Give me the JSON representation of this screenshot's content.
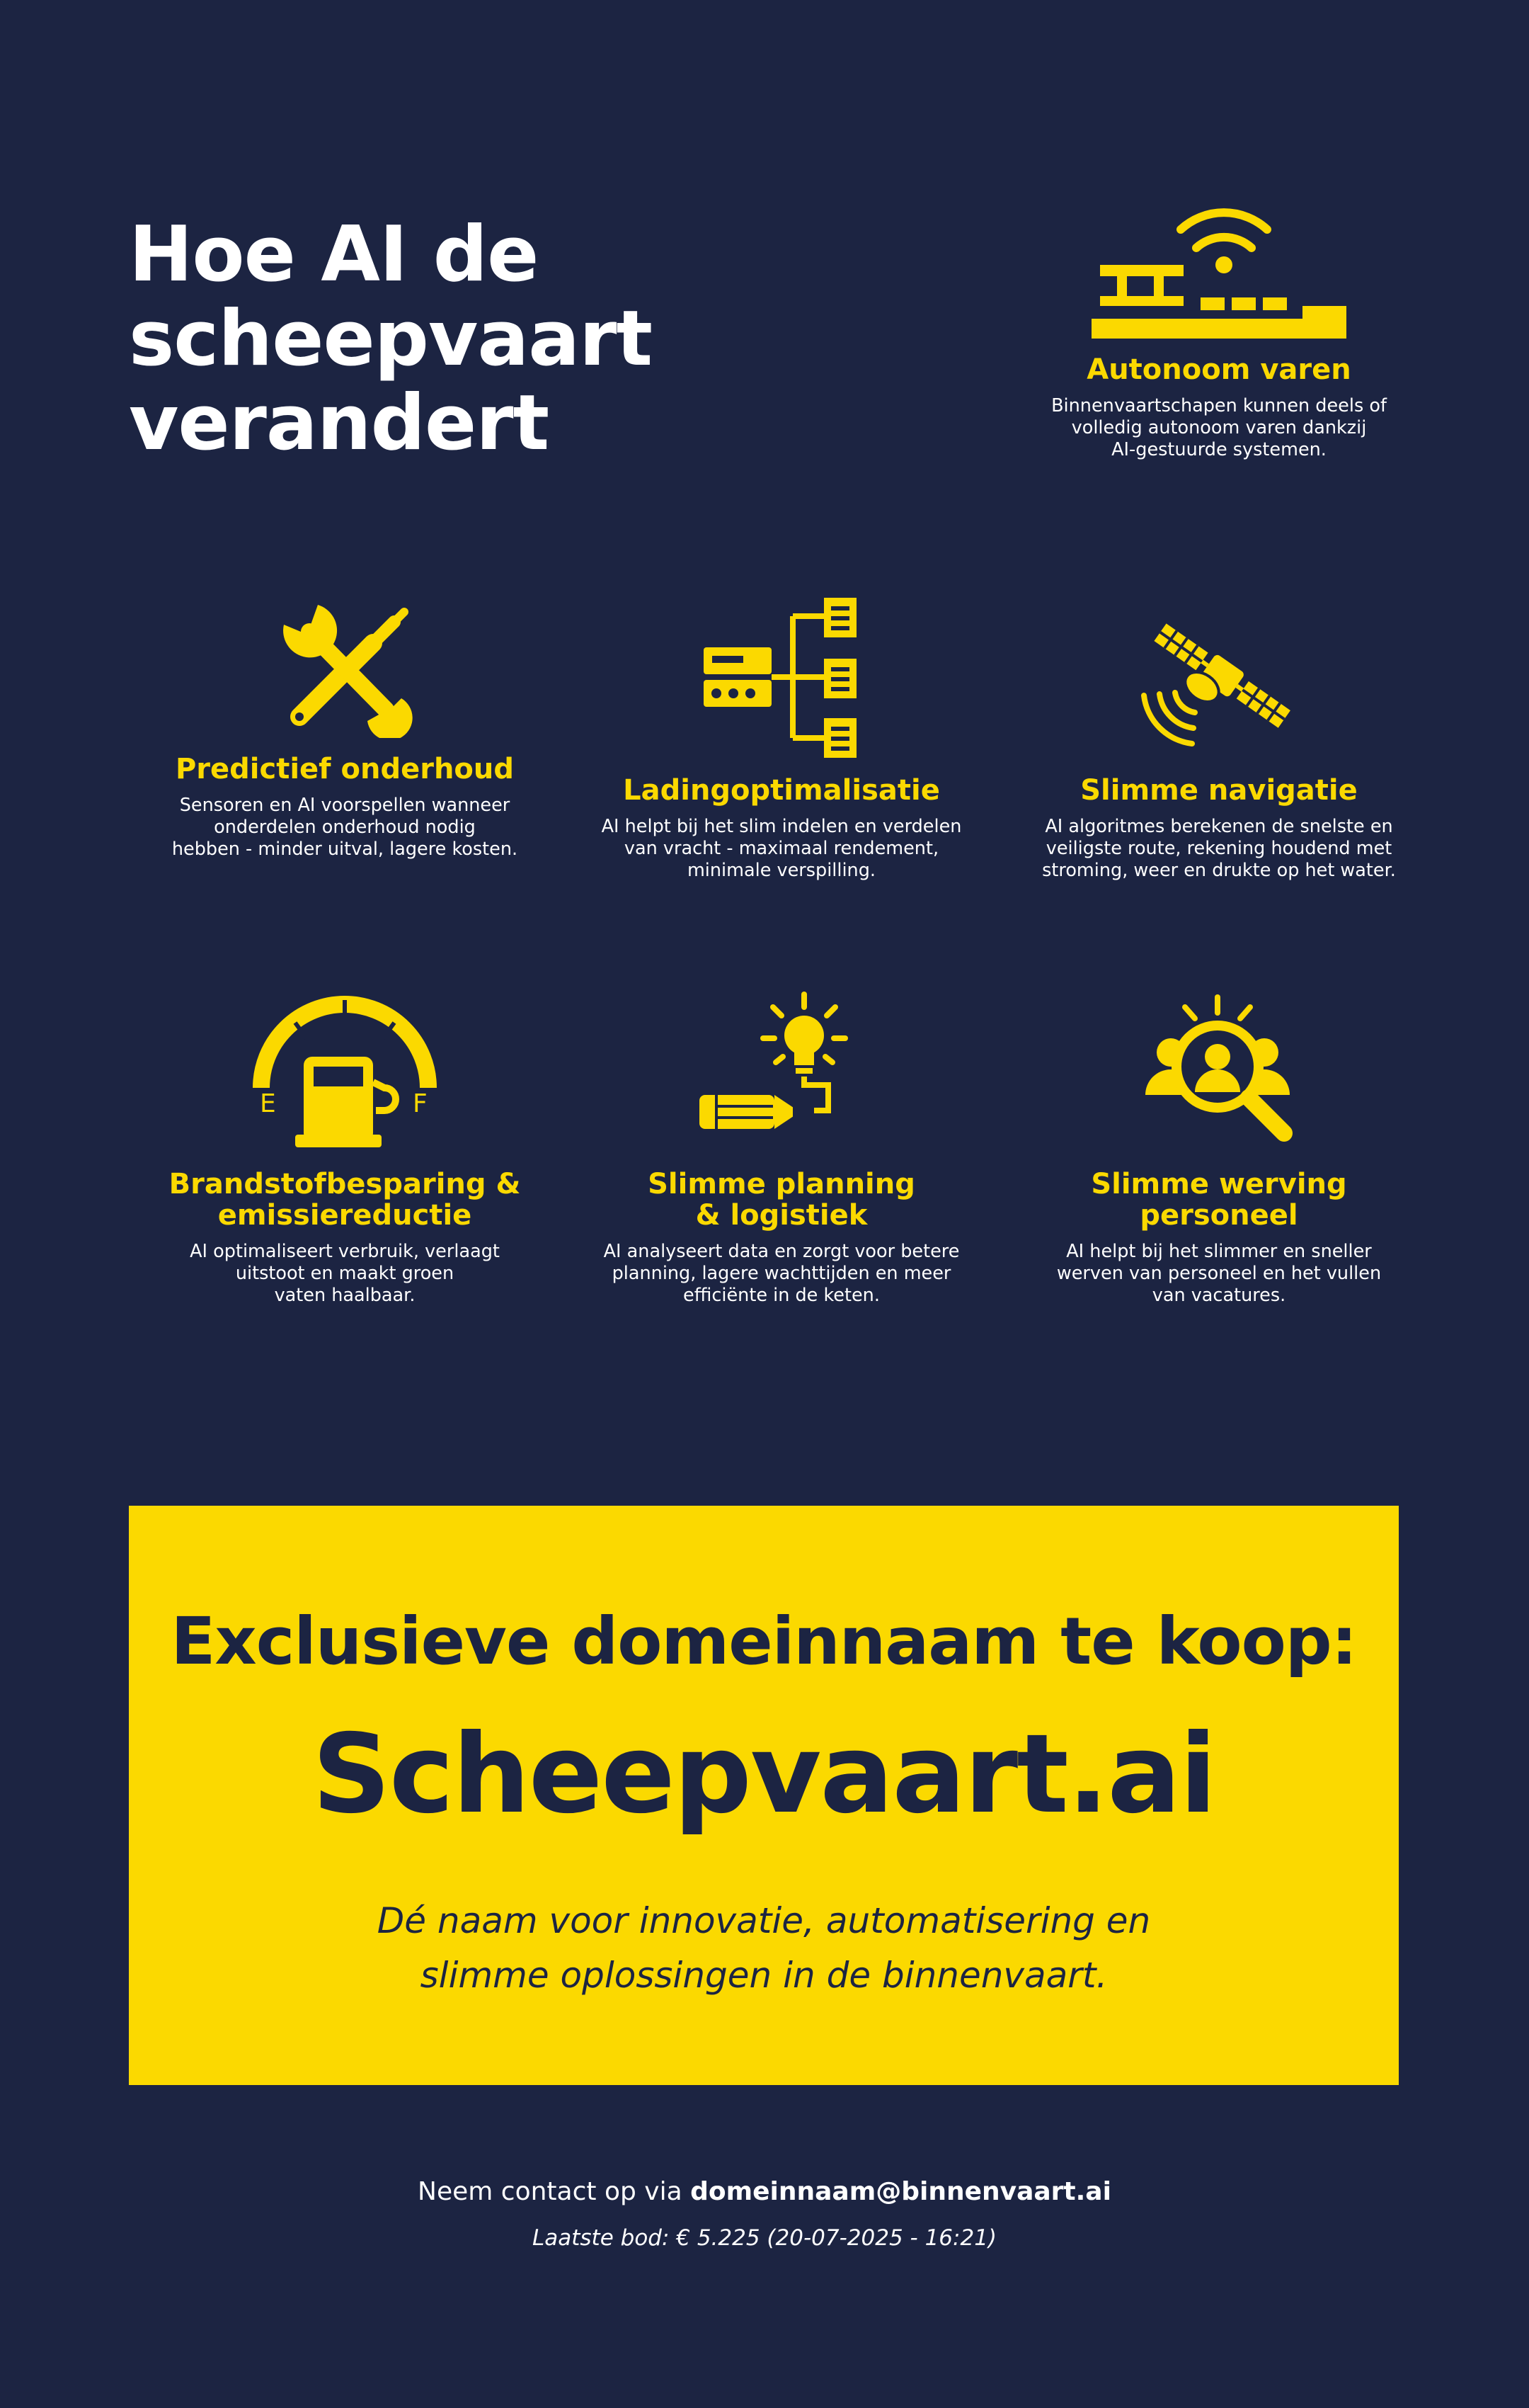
{
  "colors": {
    "background": "#1c2442",
    "accent": "#fbd900",
    "text": "#ffffff"
  },
  "hero": {
    "title_lines": [
      "Hoe AI de",
      "scheepvaart",
      "verandert"
    ]
  },
  "features": [
    {
      "icon": "ship-wifi-icon",
      "title_lines": [
        "Autonoom varen"
      ],
      "desc_lines": [
        "Binnenvaartschapen kunnen deels of",
        "volledig autonoom varen dankzij",
        "AI-gestuurde systemen."
      ]
    },
    {
      "icon": "wrench-screwdriver-icon",
      "title_lines": [
        "Predictief onderhoud"
      ],
      "desc_lines": [
        "Sensoren en AI voorspellen wanneer",
        "onderdelen onderhoud nodig",
        "hebben - minder uitval, lagere kosten."
      ]
    },
    {
      "icon": "cargo-distribution-icon",
      "title_lines": [
        "Ladingoptimalisatie"
      ],
      "desc_lines": [
        "AI helpt bij het slim indelen en verdelen",
        "van vracht - maximaal rendement,",
        "minimale verspilling."
      ]
    },
    {
      "icon": "satellite-icon",
      "title_lines": [
        "Slimme navigatie"
      ],
      "desc_lines": [
        "AI algoritmes berekenen de snelste en",
        "veiligste route, rekening houdend met",
        "stroming, weer en drukte op het water."
      ]
    },
    {
      "icon": "fuel-gauge-icon",
      "title_lines": [
        "Brandstofbesparing &",
        "emissiereductie"
      ],
      "desc_lines": [
        "AI optimaliseert verbruik, verlaagt",
        "uitstoot en maakt groen",
        "vaten haalbaar."
      ],
      "gauge_labels": [
        "E",
        "F"
      ]
    },
    {
      "icon": "pencil-lightbulb-icon",
      "title_lines": [
        "Slimme planning",
        "& logistiek"
      ],
      "desc_lines": [
        "AI analyseert data en zorgt voor betere",
        "planning, lagere wachttijden en meer",
        "efficiënte in de keten."
      ]
    },
    {
      "icon": "recruitment-magnifier-icon",
      "title_lines": [
        "Slimme werving",
        "personeel"
      ],
      "desc_lines": [
        "AI helpt bij het slimmer en sneller",
        "werven van personeel en het vullen",
        "van vacatures."
      ]
    }
  ],
  "banner": {
    "heading": "Exclusieve domeinnaam te koop:",
    "domain": "Scheepvaart.ai",
    "tagline_lines": [
      "Dé naam voor innovatie, automatisering en",
      "slimme oplossingen in de binnenvaart."
    ]
  },
  "contact": {
    "prefix": "Neem contact op via ",
    "email": "domeinnaam@binnenvaart.ai",
    "bid": "Laatste bod: € 5.225 (20-07-2025 - 16:21)"
  }
}
